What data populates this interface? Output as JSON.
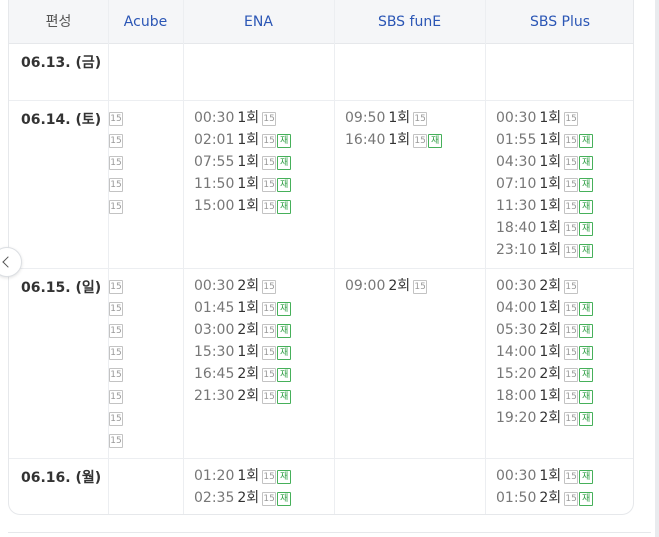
{
  "header": {
    "label": "편성",
    "channels": [
      "Acube",
      "ENA",
      "SBS funE",
      "SBS Plus"
    ]
  },
  "badges": {
    "age": "15",
    "rerun": "재"
  },
  "rows": [
    {
      "date": "06.13. (금)",
      "acube_count": 0,
      "ena": [],
      "funE": [],
      "plus": []
    },
    {
      "date": "06.14. (토)",
      "acube_count": 5,
      "ena": [
        {
          "time": "00:30",
          "ep": "1회",
          "rerun": false
        },
        {
          "time": "02:01",
          "ep": "1회",
          "rerun": true
        },
        {
          "time": "07:55",
          "ep": "1회",
          "rerun": true
        },
        {
          "time": "11:50",
          "ep": "1회",
          "rerun": true
        },
        {
          "time": "15:00",
          "ep": "1회",
          "rerun": true
        }
      ],
      "funE": [
        {
          "time": "09:50",
          "ep": "1회",
          "rerun": false
        },
        {
          "time": "16:40",
          "ep": "1회",
          "rerun": true
        }
      ],
      "plus": [
        {
          "time": "00:30",
          "ep": "1회",
          "rerun": false
        },
        {
          "time": "01:55",
          "ep": "1회",
          "rerun": true
        },
        {
          "time": "04:30",
          "ep": "1회",
          "rerun": true
        },
        {
          "time": "07:10",
          "ep": "1회",
          "rerun": true
        },
        {
          "time": "11:30",
          "ep": "1회",
          "rerun": true
        },
        {
          "time": "18:40",
          "ep": "1회",
          "rerun": true
        },
        {
          "time": "23:10",
          "ep": "1회",
          "rerun": true
        }
      ]
    },
    {
      "date": "06.15. (일)",
      "acube_count": 8,
      "ena": [
        {
          "time": "00:30",
          "ep": "2회",
          "rerun": false
        },
        {
          "time": "01:45",
          "ep": "1회",
          "rerun": true
        },
        {
          "time": "03:00",
          "ep": "2회",
          "rerun": true
        },
        {
          "time": "15:30",
          "ep": "1회",
          "rerun": true
        },
        {
          "time": "16:45",
          "ep": "2회",
          "rerun": true
        },
        {
          "time": "21:30",
          "ep": "2회",
          "rerun": true
        }
      ],
      "funE": [
        {
          "time": "09:00",
          "ep": "2회",
          "rerun": false
        }
      ],
      "plus": [
        {
          "time": "00:30",
          "ep": "2회",
          "rerun": false
        },
        {
          "time": "04:00",
          "ep": "1회",
          "rerun": true
        },
        {
          "time": "05:30",
          "ep": "2회",
          "rerun": true
        },
        {
          "time": "14:00",
          "ep": "1회",
          "rerun": true
        },
        {
          "time": "15:20",
          "ep": "2회",
          "rerun": true
        },
        {
          "time": "18:00",
          "ep": "1회",
          "rerun": true
        },
        {
          "time": "19:20",
          "ep": "2회",
          "rerun": true
        }
      ]
    },
    {
      "date": "06.16. (월)",
      "acube_count": 0,
      "ena": [
        {
          "time": "01:20",
          "ep": "1회",
          "rerun": true
        },
        {
          "time": "02:35",
          "ep": "2회",
          "rerun": true
        }
      ],
      "funE": [],
      "plus": [
        {
          "time": "00:30",
          "ep": "1회",
          "rerun": true
        },
        {
          "time": "01:50",
          "ep": "2회",
          "rerun": true
        }
      ]
    }
  ]
}
